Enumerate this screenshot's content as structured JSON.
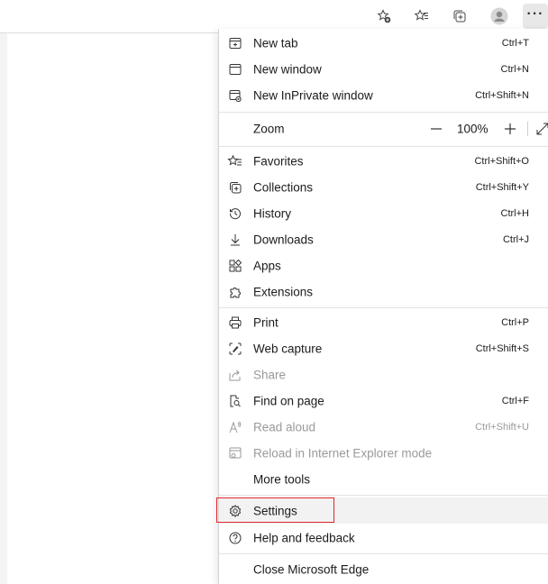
{
  "toolbar": {
    "icons": [
      "add-favorite-icon",
      "favorites-icon",
      "collections-icon",
      "profile-icon",
      "more-icon"
    ],
    "more_label": "···"
  },
  "menu": {
    "new_tab": {
      "label": "New tab",
      "shortcut": "Ctrl+T"
    },
    "new_window": {
      "label": "New window",
      "shortcut": "Ctrl+N"
    },
    "new_inprivate": {
      "label": "New InPrivate window",
      "shortcut": "Ctrl+Shift+N"
    },
    "zoom": {
      "label": "Zoom",
      "minus": "—",
      "value": "100%",
      "plus": "+"
    },
    "favorites": {
      "label": "Favorites",
      "shortcut": "Ctrl+Shift+O"
    },
    "collections": {
      "label": "Collections",
      "shortcut": "Ctrl+Shift+Y"
    },
    "history": {
      "label": "History",
      "shortcut": "Ctrl+H"
    },
    "downloads": {
      "label": "Downloads",
      "shortcut": "Ctrl+J"
    },
    "apps": {
      "label": "Apps"
    },
    "extensions": {
      "label": "Extensions"
    },
    "print": {
      "label": "Print",
      "shortcut": "Ctrl+P"
    },
    "web_capture": {
      "label": "Web capture",
      "shortcut": "Ctrl+Shift+S"
    },
    "share": {
      "label": "Share"
    },
    "find_on_page": {
      "label": "Find on page",
      "shortcut": "Ctrl+F"
    },
    "read_aloud": {
      "label": "Read aloud",
      "shortcut": "Ctrl+Shift+U"
    },
    "reload_ie": {
      "label": "Reload in Internet Explorer mode"
    },
    "more_tools": {
      "label": "More tools"
    },
    "settings": {
      "label": "Settings"
    },
    "help_feedback": {
      "label": "Help and feedback"
    },
    "close_edge": {
      "label": "Close Microsoft Edge"
    }
  },
  "colors": {
    "highlight_border": "#e0262c",
    "disabled_text": "#9a9a9a",
    "text": "#1b1b1b"
  }
}
